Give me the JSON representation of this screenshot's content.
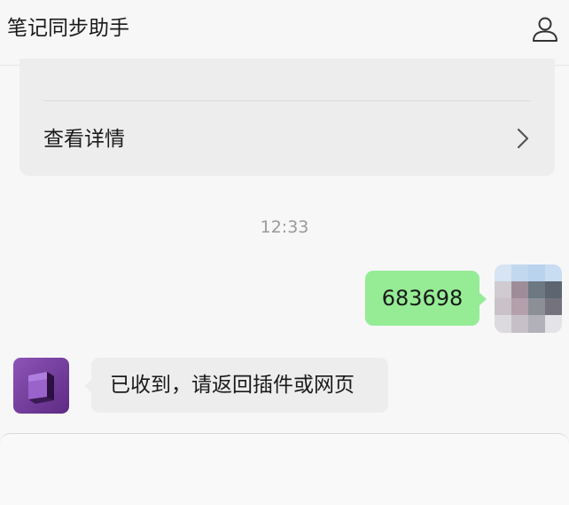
{
  "header": {
    "title": "笔记同步助手",
    "profile_icon": "user-profile-icon"
  },
  "card": {
    "action_label": "查看详情",
    "chevron_icon": "chevron-right-icon"
  },
  "chat": {
    "timestamp": "12:33",
    "messages": [
      {
        "from": "user",
        "text": "683698"
      },
      {
        "from": "bot",
        "text": "已收到，请返回插件或网页"
      }
    ]
  },
  "colors": {
    "outgoing_bubble": "#95ec95",
    "incoming_bubble": "#ededee",
    "bot_avatar": "#7b3fa6",
    "background": "#f7f7f8"
  }
}
